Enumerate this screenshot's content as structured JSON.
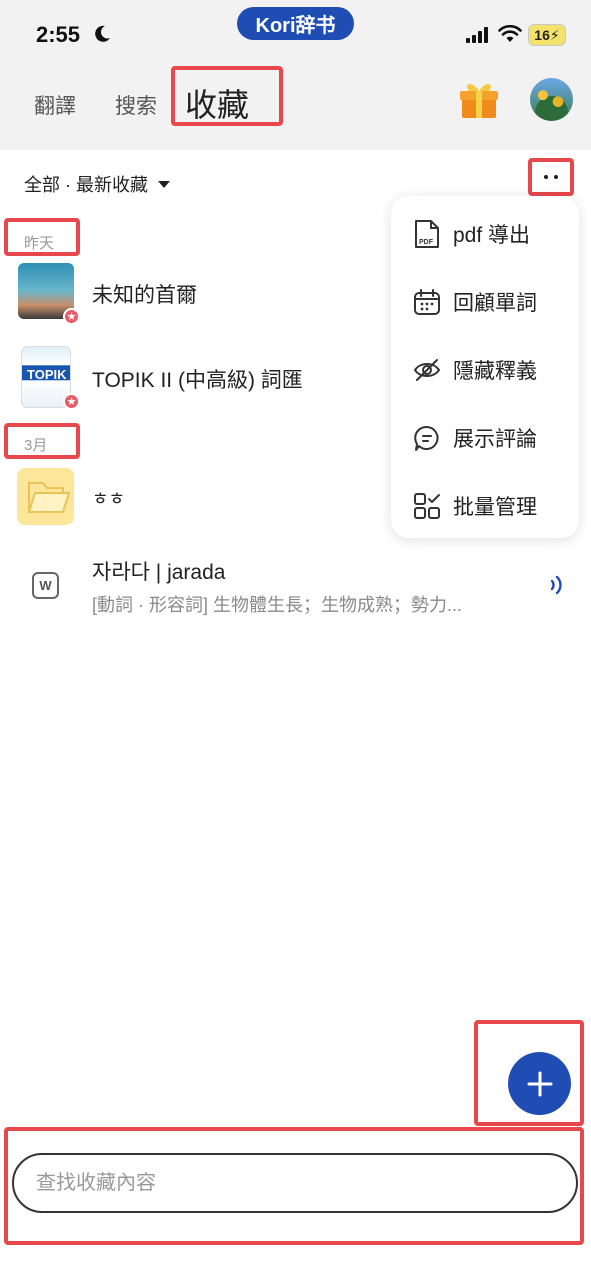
{
  "status_bar": {
    "time": "2:55",
    "app_badge": "Kori辞书",
    "battery": "16"
  },
  "header": {
    "tabs": [
      {
        "label": "翻譯"
      },
      {
        "label": "搜索"
      },
      {
        "label": "收藏"
      }
    ]
  },
  "filter": {
    "label": "全部 · 最新收藏"
  },
  "sections": [
    {
      "label": "昨天",
      "items": [
        {
          "title": "未知的首爾",
          "icon": "book-cover-thumbnail"
        },
        {
          "title": "TOPIK II (中高級) 詞匯",
          "icon": "book-cover-thumbnail",
          "cover_text": "TOPIK"
        }
      ]
    },
    {
      "label": "3月",
      "items": [
        {
          "title": "ㅎㅎ",
          "icon": "folder-icon"
        },
        {
          "title": "자라다 | jarada",
          "subtitle": "[動詞 · 形容詞] 生物體生長；生物成熟；勢力...",
          "icon": "word-icon",
          "icon_letter": "W"
        }
      ]
    }
  ],
  "menu": {
    "items": [
      {
        "label": "pdf 導出",
        "icon": "pdf-icon",
        "icon_text": "PDF"
      },
      {
        "label": "回顧單詞",
        "icon": "calendar-icon"
      },
      {
        "label": "隱藏釋義",
        "icon": "eye-off-icon"
      },
      {
        "label": "展示評論",
        "icon": "comment-icon"
      },
      {
        "label": "批量管理",
        "icon": "grid-check-icon"
      }
    ]
  },
  "search": {
    "placeholder": "查找收藏內容"
  },
  "colors": {
    "accent": "#1f4db3",
    "highlight": "#e8474c",
    "star_badge": "#e85b68"
  }
}
